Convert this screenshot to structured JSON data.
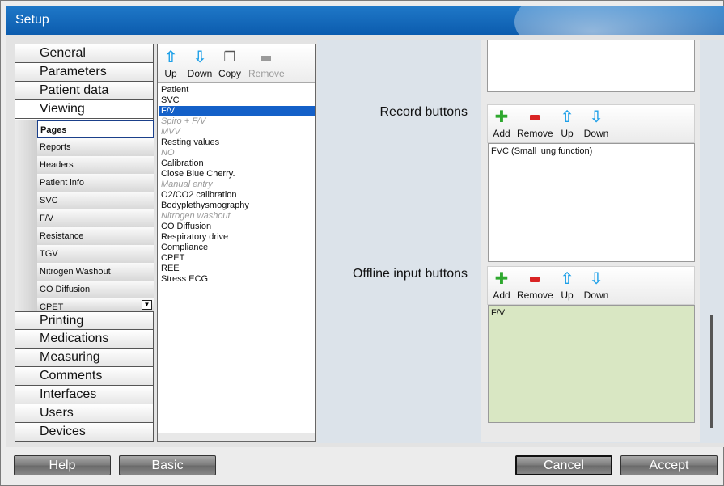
{
  "window": {
    "title": "Setup"
  },
  "nav": {
    "categories_top": [
      "General",
      "Parameters",
      "Patient data",
      "Viewing"
    ],
    "subitems": [
      "Pages",
      "Reports",
      "Headers",
      "Patient info",
      "SVC",
      "F/V",
      "Resistance",
      "TGV",
      "Nitrogen Washout",
      "CO Diffusion",
      "CPET"
    ],
    "categories_bottom": [
      "Printing",
      "Medications",
      "Measuring",
      "Comments",
      "Interfaces",
      "Users",
      "Devices"
    ]
  },
  "pages_toolbar": {
    "up": "Up",
    "down": "Down",
    "copy": "Copy",
    "remove": "Remove"
  },
  "pages": [
    {
      "label": "Patient",
      "state": "normal"
    },
    {
      "label": "SVC",
      "state": "normal"
    },
    {
      "label": "F/V",
      "state": "selected"
    },
    {
      "label": "Spiro + F/V",
      "state": "disabled"
    },
    {
      "label": "MVV",
      "state": "disabled"
    },
    {
      "label": "Resting values",
      "state": "normal"
    },
    {
      "label": "NO",
      "state": "disabled"
    },
    {
      "label": "Calibration",
      "state": "normal"
    },
    {
      "label": "Close Blue Cherry.",
      "state": "normal"
    },
    {
      "label": "Manual entry",
      "state": "disabled"
    },
    {
      "label": "O2/CO2 calibration",
      "state": "normal"
    },
    {
      "label": "Bodyplethysmography",
      "state": "normal"
    },
    {
      "label": "Nitrogen washout",
      "state": "disabled"
    },
    {
      "label": "CO Diffusion",
      "state": "normal"
    },
    {
      "label": "Respiratory drive",
      "state": "normal"
    },
    {
      "label": "Compliance",
      "state": "normal"
    },
    {
      "label": "CPET",
      "state": "normal"
    },
    {
      "label": "REE",
      "state": "normal"
    },
    {
      "label": "Stress ECG",
      "state": "normal"
    }
  ],
  "record": {
    "label": "Record buttons",
    "toolbar": {
      "add": "Add",
      "remove": "Remove",
      "up": "Up",
      "down": "Down"
    },
    "items": [
      "FVC (Small lung function)"
    ]
  },
  "offline": {
    "label": "Offline input buttons",
    "toolbar": {
      "add": "Add",
      "remove": "Remove",
      "up": "Up",
      "down": "Down"
    },
    "items": [
      "F/V"
    ]
  },
  "footer": {
    "help": "Help",
    "basic": "Basic",
    "cancel": "Cancel",
    "accept": "Accept"
  },
  "colors": {
    "title_bar": "#0c5cae",
    "selection": "#1460c8",
    "arrow": "#1ea0e8",
    "add": "#2ea82e",
    "remove": "#d92424",
    "offline_list_bg": "#d9e7c3"
  },
  "icons": {
    "up": "arrow-up-icon",
    "down": "arrow-down-icon",
    "copy": "copy-icon",
    "remove": "remove-icon",
    "add": "plus-icon"
  }
}
